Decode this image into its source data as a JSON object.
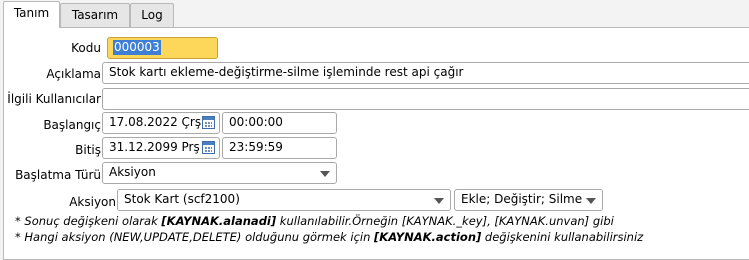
{
  "tabs": [
    {
      "label": "Tanım",
      "active": true
    },
    {
      "label": "Tasarım",
      "active": false
    },
    {
      "label": "Log",
      "active": false
    }
  ],
  "form": {
    "kodu": {
      "label": "Kodu",
      "value": "000003"
    },
    "aciklama": {
      "label": "Açıklama",
      "value": "Stok kartı ekleme-değiştirme-silme işleminde rest api çağır"
    },
    "ilgili_kullanicilar": {
      "label": "İlgili Kullanıcılar",
      "value": ""
    },
    "baslangic": {
      "label": "Başlangıç",
      "date": "17.08.2022 Çrş",
      "time": "00:00:00"
    },
    "bitis": {
      "label": "Bitiş",
      "date": "31.12.2099 Prş",
      "time": "23:59:59"
    },
    "baslatma_turu": {
      "label": "Başlatma Türü",
      "value": "Aksiyon"
    },
    "aksiyon": {
      "label": "Aksiyon",
      "value": "Stok Kart (scf2100)",
      "operations": "Ekle; Değiştir; Silme"
    }
  },
  "notes": {
    "line1": {
      "pre": "* Sonuç değişkeni olarak ",
      "bold": "[KAYNAK.alanadi]",
      "post": " kullanılabilir.Örneğin [KAYNAK._key], [KAYNAK.unvan] gibi"
    },
    "line2": {
      "pre": "* Hangi aksiyon (NEW,UPDATE,DELETE) olduğunu görmek için ",
      "bold": "[KAYNAK.action]",
      "post": " değişkenini kullanabilirsiniz"
    }
  },
  "colors": {
    "code_field_bg": "#fdd75a",
    "selection_bg": "#3e7fd5",
    "panel_bg": "#ffffff",
    "window_bg": "#f3f3f3"
  }
}
